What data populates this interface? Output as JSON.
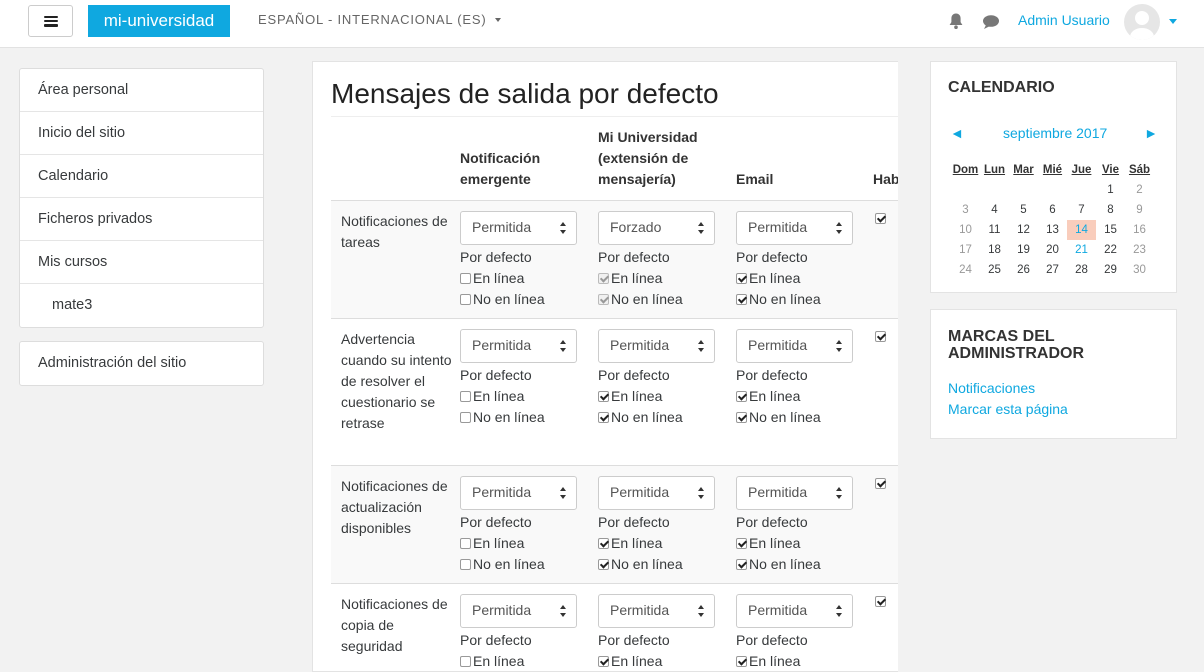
{
  "navbar": {
    "brand": "mi-universidad",
    "language": "ESPAÑOL - INTERNACIONAL (ES)",
    "user_name": "Admin Usuario"
  },
  "left_nav": {
    "items": [
      "Área personal",
      "Inicio del sitio",
      "Calendario",
      "Ficheros privados",
      "Mis cursos",
      "mate3"
    ],
    "admin": "Administración del sitio"
  },
  "page": {
    "title": "Mensajes de salida por defecto",
    "columns": {
      "popup": [
        "Notificación",
        "emergente"
      ],
      "mobile": [
        "Mi Universidad",
        "(extensión de",
        "mensajería)"
      ],
      "email": "Email",
      "enabled": "Hab"
    },
    "default_label": "Por defecto",
    "online_label": "En línea",
    "offline_label": "No en línea",
    "rows": [
      {
        "name": "Notificaciones de tareas",
        "popup": {
          "select": "Permitida",
          "online": false,
          "offline": false
        },
        "mobile": {
          "select": "Forzado",
          "online": true,
          "offline": true
        },
        "email": {
          "select": "Permitida",
          "online": true,
          "offline": true
        },
        "enabled": true
      },
      {
        "name": "Advertencia cuando su intento de resolver el cuestionario se retrase",
        "popup": {
          "select": "Permitida",
          "online": false,
          "offline": false
        },
        "mobile": {
          "select": "Permitida",
          "online": true,
          "offline": true
        },
        "email": {
          "select": "Permitida",
          "online": true,
          "offline": true
        },
        "enabled": true
      },
      {
        "name": "Notificaciones de actualización disponibles",
        "popup": {
          "select": "Permitida",
          "online": false,
          "offline": false
        },
        "mobile": {
          "select": "Permitida",
          "online": true,
          "offline": true
        },
        "email": {
          "select": "Permitida",
          "online": true,
          "offline": true
        },
        "enabled": true
      },
      {
        "name": "Notificaciones de copia de seguridad",
        "popup": {
          "select": "Permitida",
          "online": false,
          "offline": false
        },
        "mobile": {
          "select": "Permitida",
          "online": true,
          "offline": true
        },
        "email": {
          "select": "Permitida",
          "online": true,
          "offline": true
        },
        "enabled": true
      }
    ]
  },
  "calendar": {
    "title": "CALENDARIO",
    "month": "septiembre 2017",
    "prev": "◄",
    "next": "►",
    "weekdays": [
      "Dom",
      "Lun",
      "Mar",
      "Mié",
      "Jue",
      "Vie",
      "Sáb"
    ],
    "weeks": [
      [
        "",
        "",
        "",
        "",
        "",
        "1",
        "2"
      ],
      [
        "3",
        "4",
        "5",
        "6",
        "7",
        "8",
        "9"
      ],
      [
        "10",
        "11",
        "12",
        "13",
        "14",
        "15",
        "16"
      ],
      [
        "17",
        "18",
        "19",
        "20",
        "21",
        "22",
        "23"
      ],
      [
        "24",
        "25",
        "26",
        "27",
        "28",
        "29",
        "30"
      ]
    ],
    "today": "14",
    "highlighted": [
      "21"
    ]
  },
  "admin_marks": {
    "title_line1": "MARCAS DEL",
    "title_line2": "ADMINISTRADOR",
    "links": [
      "Notificaciones",
      "Marcar esta página"
    ]
  },
  "colors": {
    "brand": "#0fa8e0",
    "today_bg": "#f9cdbc"
  }
}
